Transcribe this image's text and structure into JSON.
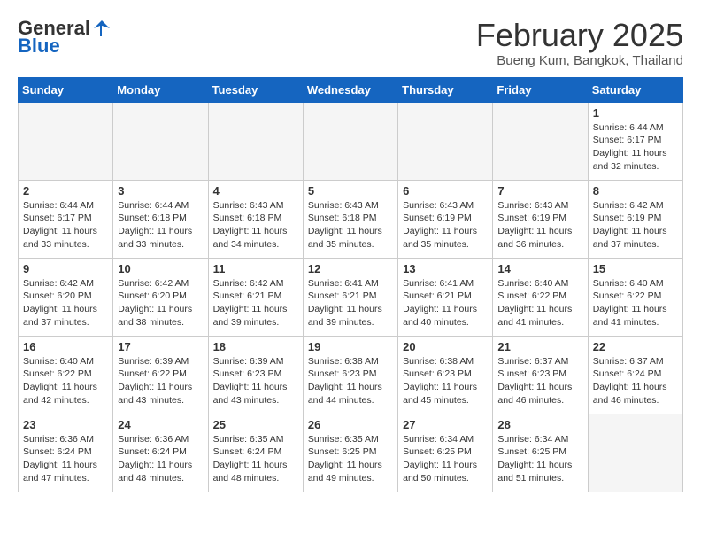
{
  "header": {
    "logo_general": "General",
    "logo_blue": "Blue",
    "month": "February 2025",
    "location": "Bueng Kum, Bangkok, Thailand"
  },
  "weekdays": [
    "Sunday",
    "Monday",
    "Tuesday",
    "Wednesday",
    "Thursday",
    "Friday",
    "Saturday"
  ],
  "weeks": [
    [
      {
        "day": "",
        "info": ""
      },
      {
        "day": "",
        "info": ""
      },
      {
        "day": "",
        "info": ""
      },
      {
        "day": "",
        "info": ""
      },
      {
        "day": "",
        "info": ""
      },
      {
        "day": "",
        "info": ""
      },
      {
        "day": "1",
        "info": "Sunrise: 6:44 AM\nSunset: 6:17 PM\nDaylight: 11 hours\nand 32 minutes."
      }
    ],
    [
      {
        "day": "2",
        "info": "Sunrise: 6:44 AM\nSunset: 6:17 PM\nDaylight: 11 hours\nand 33 minutes."
      },
      {
        "day": "3",
        "info": "Sunrise: 6:44 AM\nSunset: 6:18 PM\nDaylight: 11 hours\nand 33 minutes."
      },
      {
        "day": "4",
        "info": "Sunrise: 6:43 AM\nSunset: 6:18 PM\nDaylight: 11 hours\nand 34 minutes."
      },
      {
        "day": "5",
        "info": "Sunrise: 6:43 AM\nSunset: 6:18 PM\nDaylight: 11 hours\nand 35 minutes."
      },
      {
        "day": "6",
        "info": "Sunrise: 6:43 AM\nSunset: 6:19 PM\nDaylight: 11 hours\nand 35 minutes."
      },
      {
        "day": "7",
        "info": "Sunrise: 6:43 AM\nSunset: 6:19 PM\nDaylight: 11 hours\nand 36 minutes."
      },
      {
        "day": "8",
        "info": "Sunrise: 6:42 AM\nSunset: 6:19 PM\nDaylight: 11 hours\nand 37 minutes."
      }
    ],
    [
      {
        "day": "9",
        "info": "Sunrise: 6:42 AM\nSunset: 6:20 PM\nDaylight: 11 hours\nand 37 minutes."
      },
      {
        "day": "10",
        "info": "Sunrise: 6:42 AM\nSunset: 6:20 PM\nDaylight: 11 hours\nand 38 minutes."
      },
      {
        "day": "11",
        "info": "Sunrise: 6:42 AM\nSunset: 6:21 PM\nDaylight: 11 hours\nand 39 minutes."
      },
      {
        "day": "12",
        "info": "Sunrise: 6:41 AM\nSunset: 6:21 PM\nDaylight: 11 hours\nand 39 minutes."
      },
      {
        "day": "13",
        "info": "Sunrise: 6:41 AM\nSunset: 6:21 PM\nDaylight: 11 hours\nand 40 minutes."
      },
      {
        "day": "14",
        "info": "Sunrise: 6:40 AM\nSunset: 6:22 PM\nDaylight: 11 hours\nand 41 minutes."
      },
      {
        "day": "15",
        "info": "Sunrise: 6:40 AM\nSunset: 6:22 PM\nDaylight: 11 hours\nand 41 minutes."
      }
    ],
    [
      {
        "day": "16",
        "info": "Sunrise: 6:40 AM\nSunset: 6:22 PM\nDaylight: 11 hours\nand 42 minutes."
      },
      {
        "day": "17",
        "info": "Sunrise: 6:39 AM\nSunset: 6:22 PM\nDaylight: 11 hours\nand 43 minutes."
      },
      {
        "day": "18",
        "info": "Sunrise: 6:39 AM\nSunset: 6:23 PM\nDaylight: 11 hours\nand 43 minutes."
      },
      {
        "day": "19",
        "info": "Sunrise: 6:38 AM\nSunset: 6:23 PM\nDaylight: 11 hours\nand 44 minutes."
      },
      {
        "day": "20",
        "info": "Sunrise: 6:38 AM\nSunset: 6:23 PM\nDaylight: 11 hours\nand 45 minutes."
      },
      {
        "day": "21",
        "info": "Sunrise: 6:37 AM\nSunset: 6:23 PM\nDaylight: 11 hours\nand 46 minutes."
      },
      {
        "day": "22",
        "info": "Sunrise: 6:37 AM\nSunset: 6:24 PM\nDaylight: 11 hours\nand 46 minutes."
      }
    ],
    [
      {
        "day": "23",
        "info": "Sunrise: 6:36 AM\nSunset: 6:24 PM\nDaylight: 11 hours\nand 47 minutes."
      },
      {
        "day": "24",
        "info": "Sunrise: 6:36 AM\nSunset: 6:24 PM\nDaylight: 11 hours\nand 48 minutes."
      },
      {
        "day": "25",
        "info": "Sunrise: 6:35 AM\nSunset: 6:24 PM\nDaylight: 11 hours\nand 48 minutes."
      },
      {
        "day": "26",
        "info": "Sunrise: 6:35 AM\nSunset: 6:25 PM\nDaylight: 11 hours\nand 49 minutes."
      },
      {
        "day": "27",
        "info": "Sunrise: 6:34 AM\nSunset: 6:25 PM\nDaylight: 11 hours\nand 50 minutes."
      },
      {
        "day": "28",
        "info": "Sunrise: 6:34 AM\nSunset: 6:25 PM\nDaylight: 11 hours\nand 51 minutes."
      },
      {
        "day": "",
        "info": ""
      }
    ]
  ]
}
